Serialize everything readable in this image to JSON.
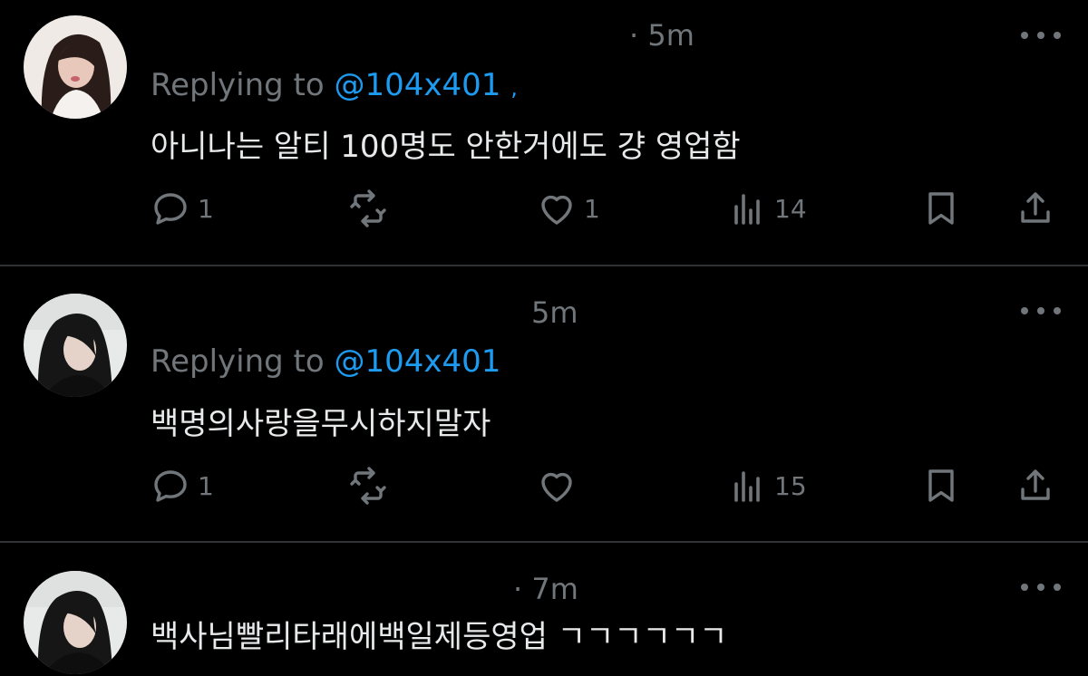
{
  "tweets": [
    {
      "time": "· 5m",
      "replying_prefix": "Replying to",
      "handle": "@104x401",
      "text": "아니나는 알티 100명도 안한거에도 걍 영업함",
      "reply_count": "1",
      "like_count": "1",
      "view_count": "14"
    },
    {
      "time": "5m",
      "replying_prefix": "Replying to",
      "handle": "@104x401",
      "text": "백명의사랑을무시하지말자",
      "reply_count": "1",
      "like_count": "",
      "view_count": "15"
    },
    {
      "time": "· 7m",
      "text": "백사님빨리타래에백일제등영업 ㄱㄱㄱㄱㄱㄱ"
    }
  ],
  "colors": {
    "background": "#000000",
    "text_primary": "#e7e9ea",
    "text_secondary": "#71767b",
    "accent": "#1d9bf0",
    "divider": "#2f3336"
  },
  "icons": [
    "reply-icon",
    "retweet-icon",
    "like-icon",
    "views-icon",
    "bookmark-icon",
    "share-icon",
    "more-icon"
  ]
}
